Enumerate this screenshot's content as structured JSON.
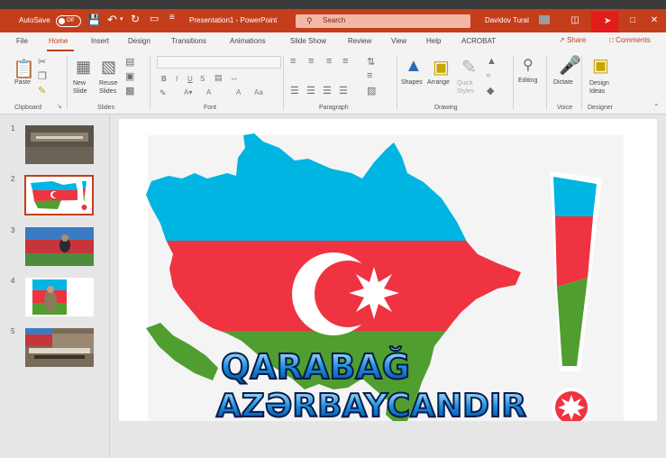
{
  "titlebar": {
    "autosave_label": "AutoSave",
    "autosave_state": "Off",
    "doc_title": "Presentation1 - PowerPoint",
    "search_placeholder": "Search",
    "user_name": "Davidov Tural"
  },
  "tabs": [
    "File",
    "Home",
    "Insert",
    "Design",
    "Transitions",
    "Animations",
    "Slide Show",
    "Review",
    "View",
    "Help",
    "ACROBAT"
  ],
  "active_tab": "Home",
  "share_label": "Share",
  "comments_label": "Comments",
  "ribbon": {
    "clipboard": {
      "paste": "Paste",
      "label": "Clipboard"
    },
    "slides": {
      "new_slide": "New Slide",
      "reuse_slides": "Reuse Slides",
      "label": "Slides"
    },
    "font": {
      "label": "Font",
      "bold": "B",
      "italic": "I",
      "underline": "U",
      "strike": "S",
      "grow": "A",
      "shrink": "A"
    },
    "paragraph": {
      "label": "Paragraph"
    },
    "drawing": {
      "shapes": "Shapes",
      "arrange": "Arrange",
      "quick_styles": "Quick Styles",
      "label": "Drawing"
    },
    "editing": {
      "label": "Editing"
    },
    "voice": {
      "dictate": "Dictate",
      "label": "Voice"
    },
    "designer": {
      "design_ideas": "Design Ideas",
      "label": "Designer"
    }
  },
  "slides": [
    {
      "number": "1"
    },
    {
      "number": "2"
    },
    {
      "number": "3"
    },
    {
      "number": "4"
    },
    {
      "number": "5"
    }
  ],
  "selected_slide": "2",
  "current_slide": {
    "line1": "QARABAĞ",
    "line2": "AZƏRBAYCANDIR"
  },
  "colors": {
    "accent": "#c43e1c",
    "flag_blue": "#00b5e2",
    "flag_red": "#ef3340",
    "flag_green": "#509e2f"
  }
}
